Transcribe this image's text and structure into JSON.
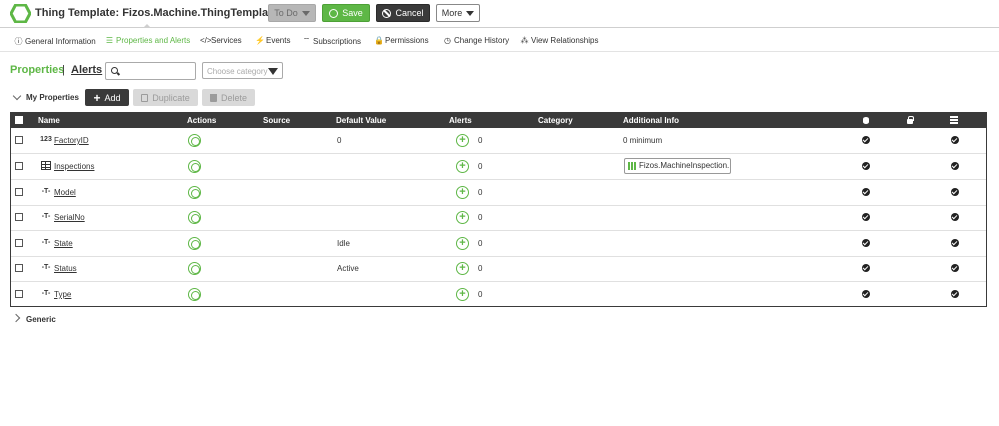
{
  "header": {
    "title_prefix": "Thing Template:",
    "title_name": "Fizos.Machine.ThingTemplate",
    "help_icon": "?",
    "todo_label": "To Do",
    "save_label": "Save",
    "cancel_label": "Cancel",
    "more_label": "More"
  },
  "tabs": [
    {
      "label": "General Information",
      "icon": "info-icon"
    },
    {
      "label": "Properties and Alerts",
      "icon": "list-icon"
    },
    {
      "label": "Services",
      "icon": "code-icon"
    },
    {
      "label": "Events",
      "icon": "bolt-icon"
    },
    {
      "label": "Subscriptions",
      "icon": "rss-icon"
    },
    {
      "label": "Permissions",
      "icon": "lock-icon"
    },
    {
      "label": "Change History",
      "icon": "clock-icon"
    },
    {
      "label": "View Relationships",
      "icon": "network-icon"
    }
  ],
  "subnav": {
    "properties_label": "Properties",
    "separator": "|",
    "alerts_label": "Alerts",
    "search_value": "",
    "category_placeholder": "Choose category"
  },
  "section": {
    "label": "My Properties",
    "add_label": "Add",
    "duplicate_label": "Duplicate",
    "delete_label": "Delete"
  },
  "table": {
    "columns": [
      "Name",
      "Actions",
      "Source",
      "Default Value",
      "Alerts",
      "Category",
      "Additional Info"
    ],
    "rows": [
      {
        "type": "123",
        "name": "FactoryID",
        "default": "0",
        "alerts": "0",
        "info": "0 minimum",
        "chip": ""
      },
      {
        "type": "table",
        "name": "Inspections",
        "default": "",
        "alerts": "0",
        "info": "",
        "chip": "Fizos.MachineInspection..."
      },
      {
        "type": "-T-",
        "name": "Model",
        "default": "",
        "alerts": "0",
        "info": "",
        "chip": ""
      },
      {
        "type": "-T-",
        "name": "SerialNo",
        "default": "",
        "alerts": "0",
        "info": "",
        "chip": ""
      },
      {
        "type": "-T-",
        "name": "State",
        "default": "Idle",
        "alerts": "0",
        "info": "",
        "chip": ""
      },
      {
        "type": "-T-",
        "name": "Status",
        "default": "Active",
        "alerts": "0",
        "info": "",
        "chip": ""
      },
      {
        "type": "-T-",
        "name": "Type",
        "default": "",
        "alerts": "0",
        "info": "",
        "chip": ""
      }
    ]
  },
  "generic_label": "Generic",
  "colors": {
    "accent_green": "#5eb746",
    "dark": "#3a3a3a"
  }
}
